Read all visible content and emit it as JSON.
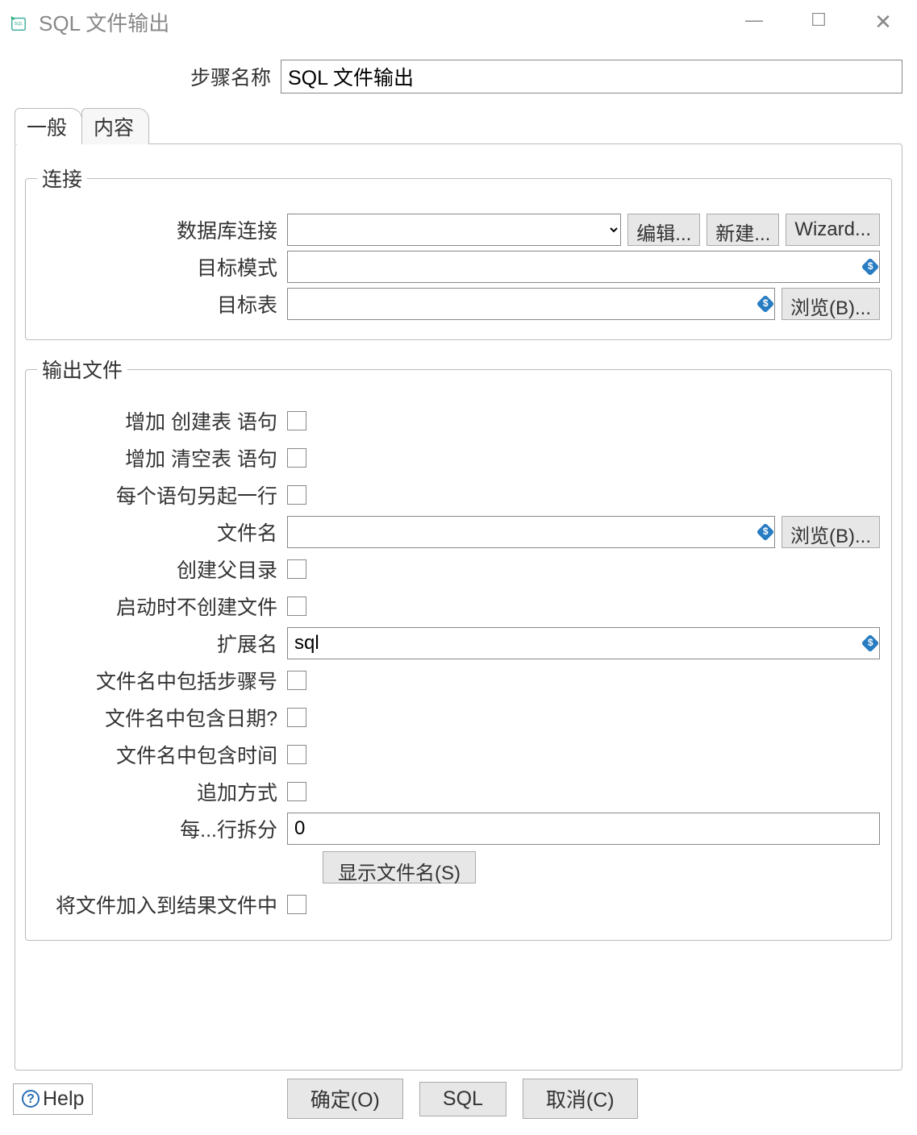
{
  "window": {
    "title": "SQL 文件输出"
  },
  "step": {
    "label": "步骤名称",
    "value": "SQL 文件输出"
  },
  "tabs": {
    "general": "一般",
    "content": "内容"
  },
  "connection_group": {
    "legend": "连接",
    "db_connection_label": "数据库连接",
    "db_connection_value": "",
    "edit_btn": "编辑...",
    "new_btn": "新建...",
    "wizard_btn": "Wizard...",
    "target_schema_label": "目标模式",
    "target_schema_value": "",
    "target_table_label": "目标表",
    "target_table_value": "",
    "browse_btn": "浏览(B)..."
  },
  "output_group": {
    "legend": "输出文件",
    "add_create_label": "增加 创建表 语句",
    "add_truncate_label": "增加 清空表 语句",
    "newline_label": "每个语句另起一行",
    "filename_label": "文件名",
    "filename_value": "",
    "browse_btn": "浏览(B)...",
    "create_parent_label": "创建父目录",
    "no_create_start_label": "启动时不创建文件",
    "extension_label": "扩展名",
    "extension_value": "sql",
    "include_stepno_label": "文件名中包括步骤号",
    "include_date_label": "文件名中包含日期?",
    "include_time_label": "文件名中包含时间",
    "append_label": "追加方式",
    "split_label": "每...行拆分",
    "split_value": "0",
    "show_filename_btn": "显示文件名(S)",
    "add_to_result_label": "将文件加入到结果文件中"
  },
  "footer": {
    "help": "Help",
    "ok": "确定(O)",
    "sql": "SQL",
    "cancel": "取消(C)"
  }
}
